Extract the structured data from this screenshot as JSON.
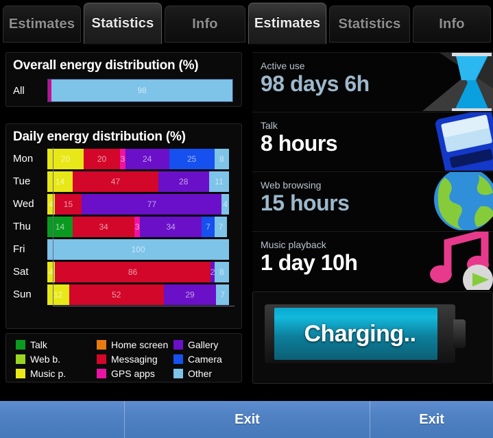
{
  "tabs": {
    "left_group": [
      {
        "label": "Estimates",
        "active": false
      },
      {
        "label": "Statistics",
        "active": true
      },
      {
        "label": "Info",
        "active": false
      }
    ],
    "right_group": [
      {
        "label": "Estimates",
        "active": true
      },
      {
        "label": "Statistics",
        "active": false
      },
      {
        "label": "Info",
        "active": false
      }
    ]
  },
  "overall": {
    "title": "Overall energy distribution (%)",
    "row_label": "All",
    "segments": [
      {
        "name": "GPS apps",
        "value": 2,
        "label": "",
        "color": "#c01090"
      },
      {
        "name": "Other",
        "value": 98,
        "label": "98",
        "color": "#7ec3e8"
      }
    ]
  },
  "daily": {
    "title": "Daily energy distribution (%)",
    "rows": [
      {
        "day": "Mon",
        "segments": [
          {
            "name": "Music p.",
            "value": 20,
            "label": "20",
            "color": "#e8e818"
          },
          {
            "name": "Messaging",
            "value": 20,
            "label": "20",
            "color": "#d2072a"
          },
          {
            "name": "GPS apps",
            "value": 3,
            "label": "3",
            "color": "#f012a0"
          },
          {
            "name": "Gallery",
            "value": 24,
            "label": "24",
            "color": "#6a10c8"
          },
          {
            "name": "Camera",
            "value": 25,
            "label": "25",
            "color": "#1650ee"
          },
          {
            "name": "Other",
            "value": 8,
            "label": "8",
            "color": "#7ec3e8"
          }
        ]
      },
      {
        "day": "Tue",
        "segments": [
          {
            "name": "Music p.",
            "value": 14,
            "label": "14",
            "color": "#e8e818"
          },
          {
            "name": "Messaging",
            "value": 47,
            "label": "47",
            "color": "#d2072a"
          },
          {
            "name": "Gallery",
            "value": 28,
            "label": "28",
            "color": "#6a10c8"
          },
          {
            "name": "Other",
            "value": 11,
            "label": "11",
            "color": "#7ec3e8"
          }
        ]
      },
      {
        "day": "Wed",
        "segments": [
          {
            "name": "Music p.",
            "value": 4,
            "label": "4",
            "color": "#e8e818"
          },
          {
            "name": "Messaging",
            "value": 15,
            "label": "15",
            "color": "#d2072a"
          },
          {
            "name": "Gallery",
            "value": 77,
            "label": "77",
            "color": "#6a10c8"
          },
          {
            "name": "Other",
            "value": 4,
            "label": "4",
            "color": "#7ec3e8"
          }
        ]
      },
      {
        "day": "Thu",
        "segments": [
          {
            "name": "Talk",
            "value": 14,
            "label": "14",
            "color": "#0a9a20"
          },
          {
            "name": "Messaging",
            "value": 34,
            "label": "34",
            "color": "#d2072a"
          },
          {
            "name": "GPS apps",
            "value": 3,
            "label": "3",
            "color": "#f012a0"
          },
          {
            "name": "Gallery",
            "value": 34,
            "label": "34",
            "color": "#6a10c8"
          },
          {
            "name": "Camera",
            "value": 7,
            "label": "7",
            "color": "#1650ee"
          },
          {
            "name": "Other",
            "value": 7,
            "label": "7",
            "color": "#7ec3e8"
          }
        ]
      },
      {
        "day": "Fri",
        "segments": [
          {
            "name": "Other",
            "value": 100,
            "label": "100",
            "color": "#7ec3e8"
          }
        ]
      },
      {
        "day": "Sat",
        "segments": [
          {
            "name": "Music p.",
            "value": 4,
            "label": "4",
            "color": "#e8e818"
          },
          {
            "name": "Messaging",
            "value": 86,
            "label": "86",
            "color": "#d2072a"
          },
          {
            "name": "Gallery",
            "value": 2,
            "label": "2",
            "color": "#6a10c8"
          },
          {
            "name": "Other",
            "value": 8,
            "label": "8",
            "color": "#7ec3e8"
          }
        ]
      },
      {
        "day": "Sun",
        "segments": [
          {
            "name": "Music p.",
            "value": 12,
            "label": "12",
            "color": "#e8e818"
          },
          {
            "name": "Messaging",
            "value": 52,
            "label": "52",
            "color": "#d2072a"
          },
          {
            "name": "Gallery",
            "value": 29,
            "label": "29",
            "color": "#6a10c8"
          },
          {
            "name": "Other",
            "value": 7,
            "label": "7",
            "color": "#7ec3e8"
          }
        ]
      }
    ]
  },
  "legend": [
    {
      "label": "Talk",
      "color": "#0a9a20"
    },
    {
      "label": "Home screen",
      "color": "#e87a10"
    },
    {
      "label": "Gallery",
      "color": "#6a10c8"
    },
    {
      "label": "Web b.",
      "color": "#9ad422"
    },
    {
      "label": "Messaging",
      "color": "#d2072a"
    },
    {
      "label": "Camera",
      "color": "#1650ee"
    },
    {
      "label": "Music p.",
      "color": "#e8e818"
    },
    {
      "label": "GPS apps",
      "color": "#ea14a4"
    },
    {
      "label": "Other",
      "color": "#7ec3e8"
    }
  ],
  "stats": [
    {
      "label": "Active use",
      "value": "98 days 6h",
      "value_color": "#9db8cc",
      "art": "hourglass-icon"
    },
    {
      "label": "Talk",
      "value": "8 hours",
      "value_color": "#ffffff",
      "art": "phone-icon"
    },
    {
      "label": "Web browsing",
      "value": "15 hours",
      "value_color": "#9db8cc",
      "art": "globe-icon"
    },
    {
      "label": "Music playback",
      "value": "1 day 10h",
      "value_color": "#ffffff",
      "art": "music-note-icon"
    }
  ],
  "battery": {
    "status_text": "Charging..",
    "fill_color": "#13b9dc"
  },
  "bottom_bar": {
    "segments": [
      {
        "label": ""
      },
      {
        "label": "Exit"
      },
      {
        "label": "Exit"
      }
    ]
  },
  "chart_data": [
    {
      "type": "bar",
      "title": "Overall energy distribution (%)",
      "orientation": "horizontal",
      "stacked": true,
      "categories": [
        "All"
      ],
      "series": [
        {
          "name": "GPS apps",
          "values": [
            2
          ]
        },
        {
          "name": "Other",
          "values": [
            98
          ]
        }
      ],
      "xlabel": "",
      "ylabel": "",
      "xlim": [
        0,
        100
      ],
      "grid": false,
      "legend": "shared-below"
    },
    {
      "type": "bar",
      "title": "Daily energy distribution (%)",
      "orientation": "horizontal",
      "stacked": true,
      "categories": [
        "Mon",
        "Tue",
        "Wed",
        "Thu",
        "Fri",
        "Sat",
        "Sun"
      ],
      "series": [
        {
          "name": "Talk",
          "values": [
            0,
            0,
            0,
            14,
            0,
            0,
            0
          ]
        },
        {
          "name": "Home screen",
          "values": [
            0,
            0,
            0,
            0,
            0,
            0,
            0
          ]
        },
        {
          "name": "Gallery",
          "values": [
            24,
            28,
            77,
            34,
            0,
            2,
            29
          ]
        },
        {
          "name": "Web b.",
          "values": [
            0,
            0,
            0,
            0,
            0,
            0,
            0
          ]
        },
        {
          "name": "Messaging",
          "values": [
            20,
            47,
            15,
            34,
            0,
            86,
            52
          ]
        },
        {
          "name": "Camera",
          "values": [
            25,
            0,
            0,
            7,
            0,
            0,
            0
          ]
        },
        {
          "name": "Music p.",
          "values": [
            20,
            14,
            4,
            0,
            0,
            4,
            12
          ]
        },
        {
          "name": "GPS apps",
          "values": [
            3,
            0,
            0,
            3,
            0,
            0,
            0
          ]
        },
        {
          "name": "Other",
          "values": [
            8,
            11,
            4,
            7,
            100,
            8,
            7
          ]
        }
      ],
      "xlabel": "",
      "ylabel": "",
      "xlim": [
        0,
        100
      ],
      "grid": false,
      "legend": "bottom"
    }
  ]
}
